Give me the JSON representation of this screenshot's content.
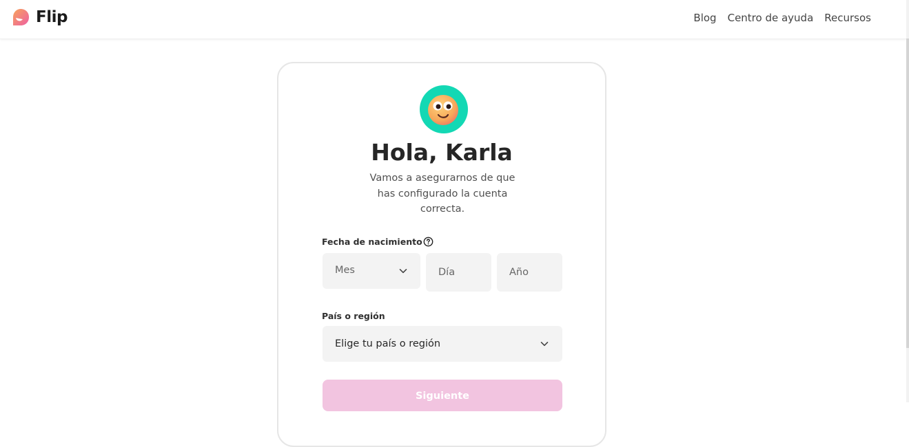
{
  "header": {
    "logo_text": "Flip",
    "nav": [
      "Blog",
      "Centro de ayuda",
      "Recursos"
    ]
  },
  "card": {
    "title": "Hola, Karla",
    "subtitle": "Vamos a asegurarnos de que has configurado la cuenta correcta.",
    "birth_label": "Fecha de nacimiento",
    "month_placeholder": "Mes",
    "day_placeholder": "Día",
    "year_placeholder": "Año",
    "country_label": "País o región",
    "country_placeholder": "Elige tu país o región",
    "next_label": "Siguiente"
  },
  "colors": {
    "avatar_bg": "#13d8b4",
    "next_button": "#f2c4e0",
    "logo_gradient_start": "#f7a35c",
    "logo_gradient_end": "#ee5fa2"
  },
  "icons": {
    "logo": "flip-logo-icon",
    "avatar": "smiling-face-avatar-icon",
    "help": "question-circle-icon",
    "month_dropdown": "chevron-down-icon",
    "country_dropdown": "chevron-down-icon"
  }
}
